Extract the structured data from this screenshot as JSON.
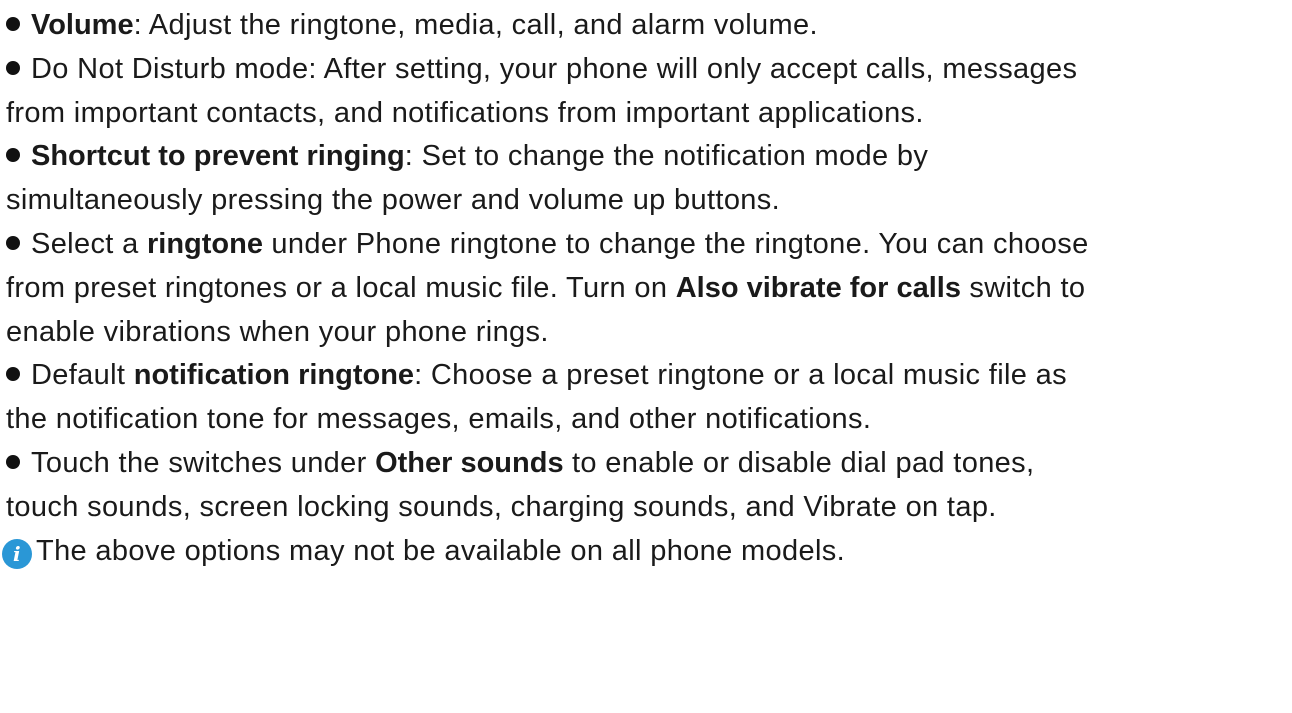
{
  "items": [
    {
      "lines": [
        [
          "",
          "Volume",
          ": Adjust the ringtone, media, call, and alarm volume."
        ]
      ]
    },
    {
      "lines": [
        [
          "Do Not Disturb mode: After setting, your phone will only accept calls, messages"
        ],
        [
          "from important contacts, and notifications from important applications."
        ]
      ]
    },
    {
      "lines": [
        [
          "",
          "Shortcut to prevent ringing",
          ": Set to change the notification mode by"
        ],
        [
          "simultaneously pressing the power and volume up buttons."
        ]
      ]
    },
    {
      "lines": [
        [
          "Select a ",
          "ringtone",
          " under Phone ringtone to change the ringtone. You can choose"
        ],
        [
          "from preset ringtones or a local music file. Turn on ",
          "Also vibrate for calls",
          " switch to"
        ],
        [
          "enable vibrations when your phone rings."
        ]
      ]
    },
    {
      "lines": [
        [
          "Default ",
          "notification ringtone",
          ": Choose a preset ringtone or a local music file as"
        ],
        [
          "the notification tone for messages, emails, and other notifications."
        ]
      ]
    },
    {
      "lines": [
        [
          "Touch the switches under ",
          "Other sounds",
          " to enable or disable dial pad tones,"
        ],
        [
          "touch sounds, screen locking sounds, charging sounds, and Vibrate on tap."
        ]
      ]
    }
  ],
  "note": {
    "icon": "info-icon",
    "icon_glyph": "i",
    "text": "The above options may not be available on all phone models."
  },
  "colors": {
    "text": "#1a1a1a",
    "info_icon": "#2a97d6"
  }
}
